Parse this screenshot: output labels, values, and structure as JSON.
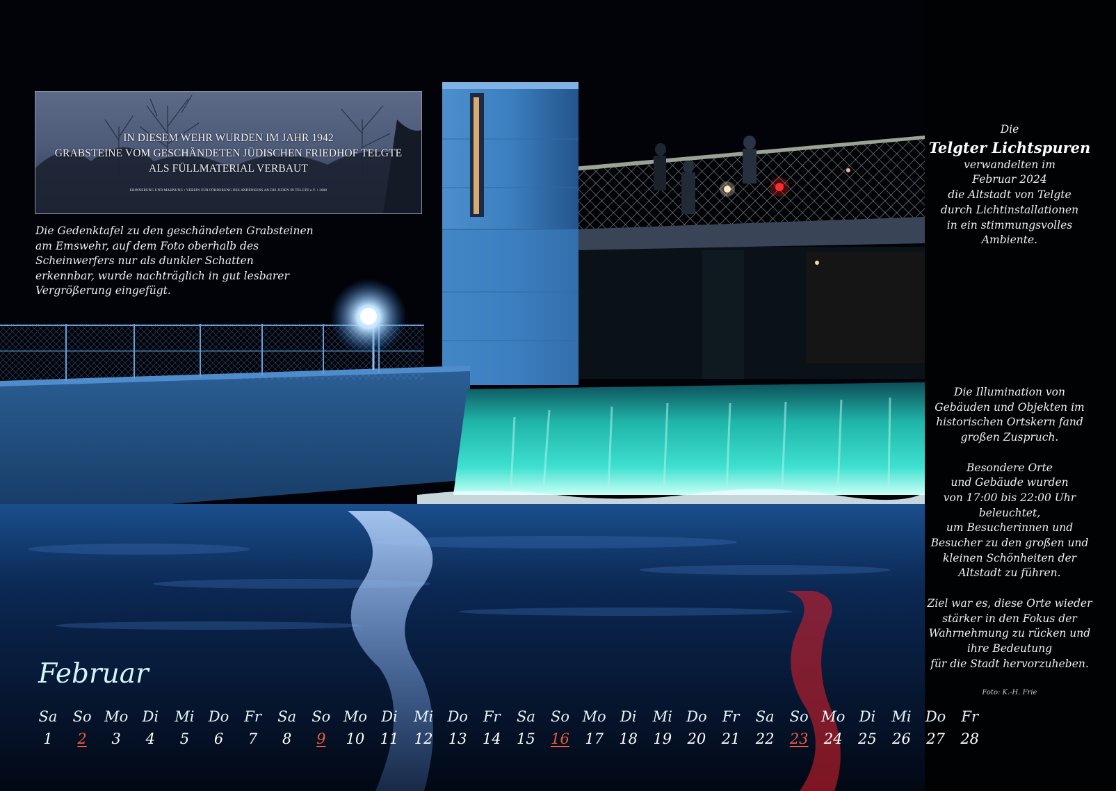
{
  "plaque": {
    "lines": [
      "IN DIESEM WEHR WURDEN IM JAHR 1942",
      "GRABSTEINE VOM GESCHÄNDETEN JÜDISCHEN FRIEDHOF TELGTE",
      "ALS FÜLLMATERIAL VERBAUT"
    ],
    "footer": "ERINNERUNG UND MAHNUNG • VEREIN ZUR FÖRDERUNG DES ANDENKENS AN DIE JUDEN IN TELGTE e.V. • 2008"
  },
  "caption": {
    "lines": [
      "Die Gedenktafel zu den geschändeten Grabsteinen",
      "am Emswehr, auf dem Foto oberhalb des",
      "Scheinwerfers nur als dunkler Schatten",
      "erkennbar, wurde nachträglich in gut lesbarer",
      "Vergrößerung eingefügt."
    ]
  },
  "intro": {
    "prefix": "Die",
    "title": "Telgter Lichtspuren",
    "lines": [
      "verwandelten im",
      "Februar 2024",
      "die Altstadt von Telgte",
      "durch Lichtinstallationen",
      "in ein stimmungsvolles",
      "Ambiente."
    ]
  },
  "description": {
    "p1": [
      "Die Illumination von",
      "Gebäuden und Objekten im",
      "historischen Ortskern fand",
      "großen Zuspruch."
    ],
    "p2": [
      "Besondere Orte",
      "und Gebäude wurden",
      "von 17:00 bis 22:00 Uhr",
      "beleuchtet,",
      "um Besucherinnen und",
      "Besucher zu den großen und",
      "kleinen Schönheiten der",
      "Altstadt zu führen."
    ],
    "p3": [
      "Ziel war es, diese Orte wieder",
      "stärker in den Fokus der",
      "Wahrnehmung zu rücken und",
      "ihre Bedeutung",
      "für die Stadt hervorzuheben."
    ]
  },
  "photo_credit": "Foto: K.-H. Frie",
  "calendar": {
    "month": "Februar",
    "weekdays": [
      "Sa",
      "So",
      "Mo",
      "Di",
      "Mi",
      "Do",
      "Fr",
      "Sa",
      "So",
      "Mo",
      "Di",
      "Mi",
      "Do",
      "Fr",
      "Sa",
      "So",
      "Mo",
      "Di",
      "Mi",
      "Do",
      "Fr",
      "Sa",
      "So",
      "Mo",
      "Di",
      "Mi",
      "Do",
      "Fr"
    ],
    "days": [
      "1",
      "2",
      "3",
      "4",
      "5",
      "6",
      "7",
      "8",
      "9",
      "10",
      "11",
      "12",
      "13",
      "14",
      "15",
      "16",
      "17",
      "18",
      "19",
      "20",
      "21",
      "22",
      "23",
      "24",
      "25",
      "26",
      "27",
      "28"
    ],
    "sundays": [
      "2",
      "9",
      "16",
      "23"
    ]
  },
  "colors": {
    "background": "#020308",
    "text": "#eef0f4",
    "month_title": "#d4f6fb",
    "sunday": "#ef5a3c",
    "waterfall": "#2fd6c4",
    "spotlight": "#bfe4ff"
  }
}
